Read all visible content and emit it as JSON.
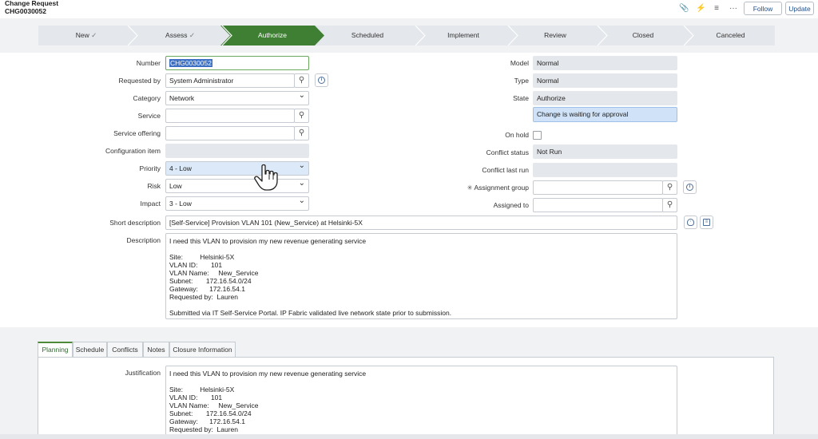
{
  "header": {
    "title_line1": "Change Request",
    "title_line2": "CHG0030052",
    "icons": [
      "paperclip-icon",
      "activity-icon",
      "settings-sliders-icon",
      "more-icon"
    ],
    "follow_label": "Follow",
    "update_label": "Update"
  },
  "stages": [
    {
      "label": "New",
      "state": "done"
    },
    {
      "label": "Assess",
      "state": "done"
    },
    {
      "label": "Authorize",
      "state": "active"
    },
    {
      "label": "Scheduled",
      "state": "pending"
    },
    {
      "label": "Implement",
      "state": "pending"
    },
    {
      "label": "Review",
      "state": "pending"
    },
    {
      "label": "Closed",
      "state": "pending"
    },
    {
      "label": "Canceled",
      "state": "pending"
    }
  ],
  "form": {
    "number": {
      "label": "Number",
      "value": "CHG0030052"
    },
    "requested_by": {
      "label": "Requested by",
      "value": "System Administrator"
    },
    "category": {
      "label": "Category",
      "value": "Network"
    },
    "service": {
      "label": "Service",
      "value": ""
    },
    "service_offering": {
      "label": "Service offering",
      "value": ""
    },
    "configuration_item": {
      "label": "Configuration item",
      "value": ""
    },
    "priority": {
      "label": "Priority",
      "value": "4 - Low"
    },
    "risk": {
      "label": "Risk",
      "value": "Low"
    },
    "impact": {
      "label": "Impact",
      "value": "3 - Low"
    },
    "model": {
      "label": "Model",
      "value": "Normal"
    },
    "type": {
      "label": "Type",
      "value": "Normal"
    },
    "state": {
      "label": "State",
      "value": "Authorize"
    },
    "approval_status": "Change is waiting for approval",
    "on_hold": {
      "label": "On hold",
      "checked": false
    },
    "conflict_status": {
      "label": "Conflict status",
      "value": "Not Run"
    },
    "conflict_last_run": {
      "label": "Conflict last run",
      "value": ""
    },
    "assignment_group": {
      "label": "Assignment group",
      "required_mark": "✳",
      "value": ""
    },
    "assigned_to": {
      "label": "Assigned to",
      "value": ""
    },
    "short_description": {
      "label": "Short description",
      "value": "[Self-Service] Provision VLAN 101 (New_Service) at Helsinki-5X"
    },
    "description": {
      "label": "Description",
      "value": "I need this VLAN to provision my new revenue generating service\n\nSite:         Helsinki-5X\nVLAN ID:       101\nVLAN Name:     New_Service\nSubnet:       172.16.54.0/24\nGateway:      172.16.54.1\nRequested by:  Lauren\n\nSubmitted via IT Self-Service Portal. IP Fabric validated live network state prior to submission."
    }
  },
  "tabs": [
    {
      "label": "Planning",
      "active": true
    },
    {
      "label": "Schedule",
      "active": false
    },
    {
      "label": "Conflicts",
      "active": false
    },
    {
      "label": "Notes",
      "active": false
    },
    {
      "label": "Closure Information",
      "active": false
    }
  ],
  "planning": {
    "justification": {
      "label": "Justification",
      "value": "I need this VLAN to provision my new revenue generating service\n\nSite:         Helsinki-5X\nVLAN ID:       101\nVLAN Name:     New_Service\nSubnet:       172.16.54.0/24\nGateway:      172.16.54.1\nRequested by:  Lauren"
    }
  },
  "colors": {
    "active_stage": "#3f7f34",
    "pipeline": "#e4e7eb",
    "highlight_field": "#dbe9f8",
    "approval_box": "#cfe2f7"
  }
}
